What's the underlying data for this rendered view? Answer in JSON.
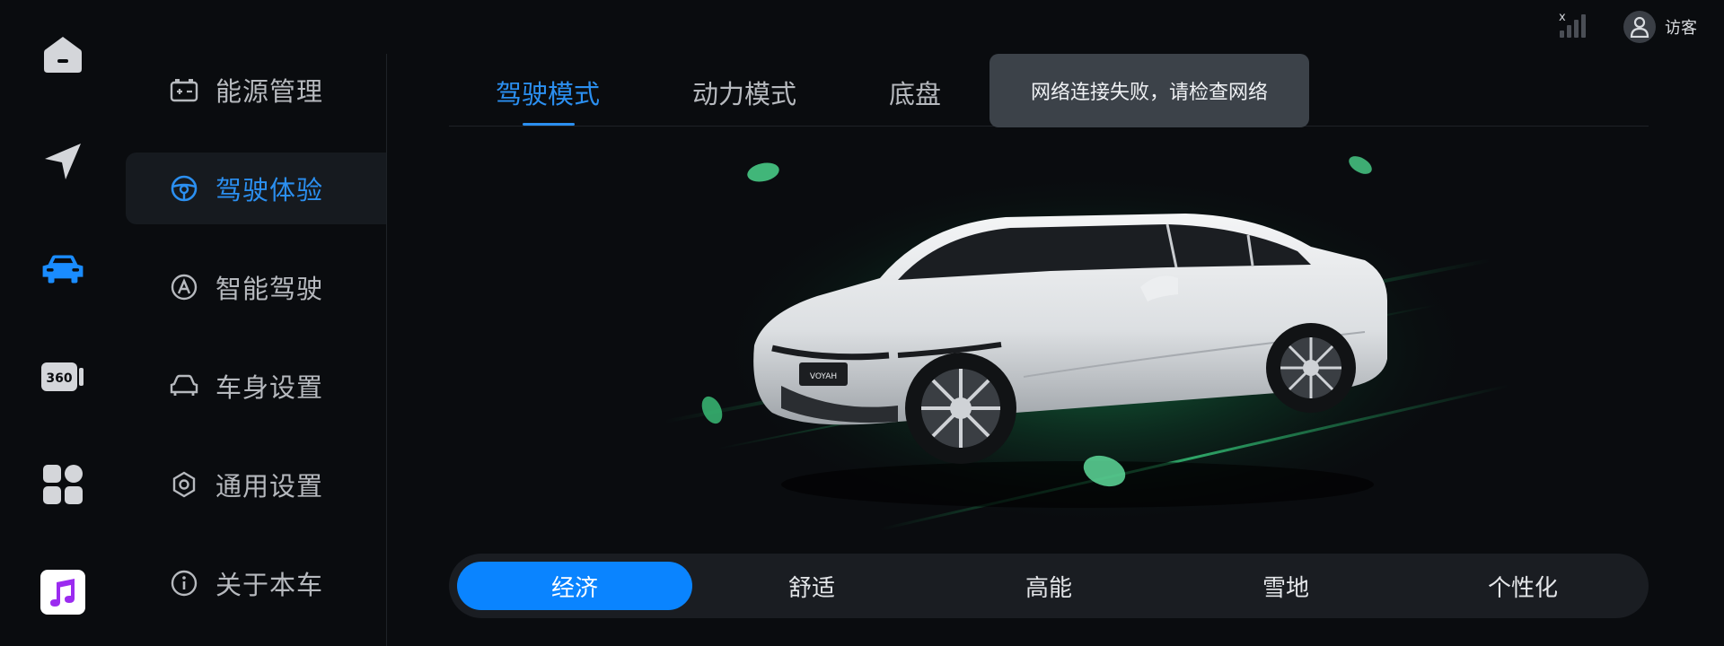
{
  "status": {
    "signal_mark": "x",
    "user_name": "访客"
  },
  "rail": {
    "icons": [
      "home-icon",
      "navigation-icon",
      "car-icon",
      "camera-360-icon",
      "apps-icon",
      "music-app-icon"
    ],
    "camera_label": "360",
    "active": "car-icon"
  },
  "sidebar": {
    "items": [
      {
        "label": "能源管理",
        "icon": "battery-icon"
      },
      {
        "label": "驾驶体验",
        "icon": "steering-wheel-icon",
        "active": true
      },
      {
        "label": "智能驾驶",
        "icon": "autopilot-icon"
      },
      {
        "label": "车身设置",
        "icon": "car-body-icon"
      },
      {
        "label": "通用设置",
        "icon": "settings-icon"
      },
      {
        "label": "关于本车",
        "icon": "info-icon"
      }
    ]
  },
  "tabs": [
    {
      "label": "驾驶模式",
      "active": true
    },
    {
      "label": "动力模式"
    },
    {
      "label": "底盘"
    }
  ],
  "toast": "网络连接失败，请检查网络",
  "car": {
    "plate": "VOYAH"
  },
  "modes": [
    {
      "label": "经济",
      "active": true
    },
    {
      "label": "舒适"
    },
    {
      "label": "高能"
    },
    {
      "label": "雪地"
    },
    {
      "label": "个性化"
    }
  ],
  "colors": {
    "accent": "#2b8ff0",
    "active_mode": "#0a84ff",
    "toast_bg": "#3c4249",
    "glow": "#1fbf6a"
  }
}
